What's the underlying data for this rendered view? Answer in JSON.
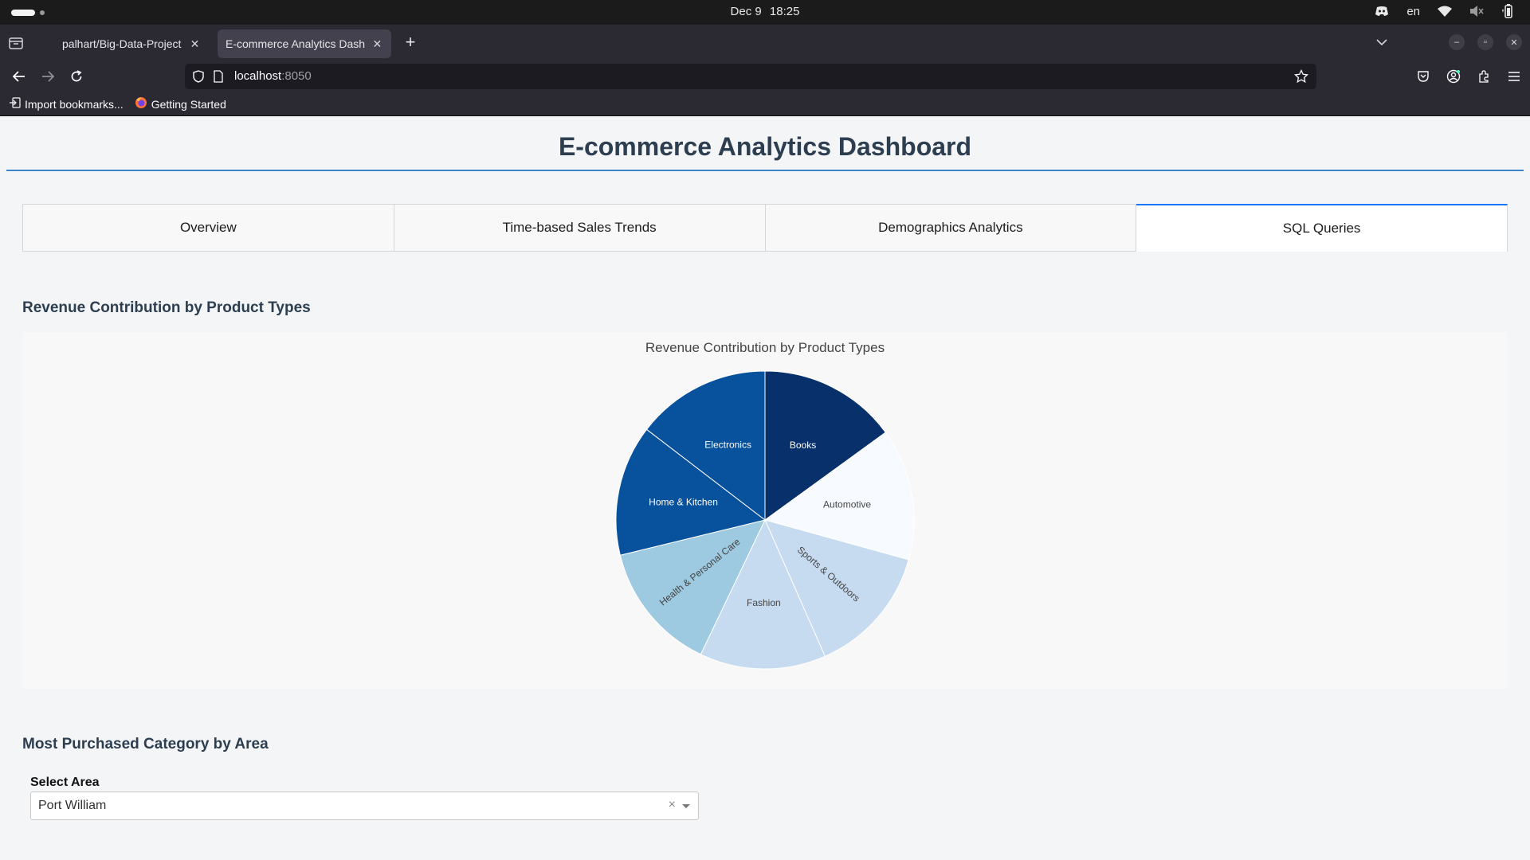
{
  "os": {
    "date": "Dec 9",
    "time": "18:25",
    "language": "en"
  },
  "browser": {
    "tabs": [
      {
        "title": "palhart/Big-Data-Project",
        "active": false
      },
      {
        "title": "E-commerce Analytics Dashboard",
        "active": true
      }
    ],
    "url_host": "localhost",
    "url_port": ":8050",
    "bookmarks": [
      {
        "label": "Import bookmarks...",
        "icon": "import-icon"
      },
      {
        "label": "Getting Started",
        "icon": "firefox-icon"
      }
    ]
  },
  "dashboard": {
    "title": "E-commerce Analytics Dashboard",
    "tabs": [
      {
        "label": "Overview"
      },
      {
        "label": "Time-based Sales Trends"
      },
      {
        "label": "Demographics Analytics"
      },
      {
        "label": "SQL Queries"
      }
    ],
    "active_tab": "SQL Queries",
    "section_revenue": "Revenue Contribution by Product Types",
    "section_area": "Most Purchased Category by Area",
    "area_filter": {
      "label": "Select Area",
      "value": "Port William"
    }
  },
  "chart_data": {
    "type": "pie",
    "title": "Revenue Contribution by Product Types",
    "labels": [
      "Books",
      "Automotive",
      "Sports & Outdoors",
      "Fashion",
      "Health & Personal Care",
      "Home & Kitchen",
      "Electronics"
    ],
    "values": [
      15.0,
      14.3,
      14.1,
      13.7,
      14.1,
      14.2,
      14.6
    ],
    "units": "share of revenue (%)",
    "colorscale": "Blues",
    "colors": [
      "#08306b",
      "#f7fbff",
      "#c6dbef",
      "#c6dbef",
      "#9ecae1",
      "#08519c",
      "#08519c"
    ],
    "legend": "none",
    "direction": "clockwise",
    "start_angle_deg": 90
  }
}
